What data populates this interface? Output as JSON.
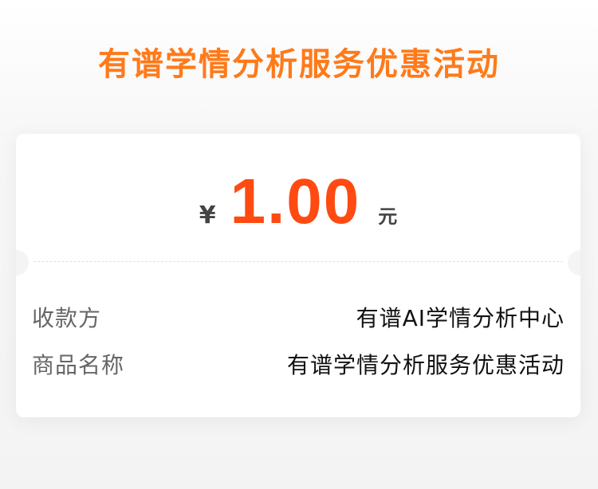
{
  "header": {
    "title": "有谱学情分析服务优惠活动"
  },
  "payment": {
    "currency_symbol": "¥",
    "amount": "1.00",
    "unit": "元"
  },
  "details": [
    {
      "label": "收款方",
      "value": "有谱AI学情分析中心"
    },
    {
      "label": "商品名称",
      "value": "有谱学情分析服务优惠活动"
    }
  ],
  "colors": {
    "title": "#ff7a1a",
    "amount": "#ff4a12",
    "label": "#666666",
    "value": "#111111"
  }
}
